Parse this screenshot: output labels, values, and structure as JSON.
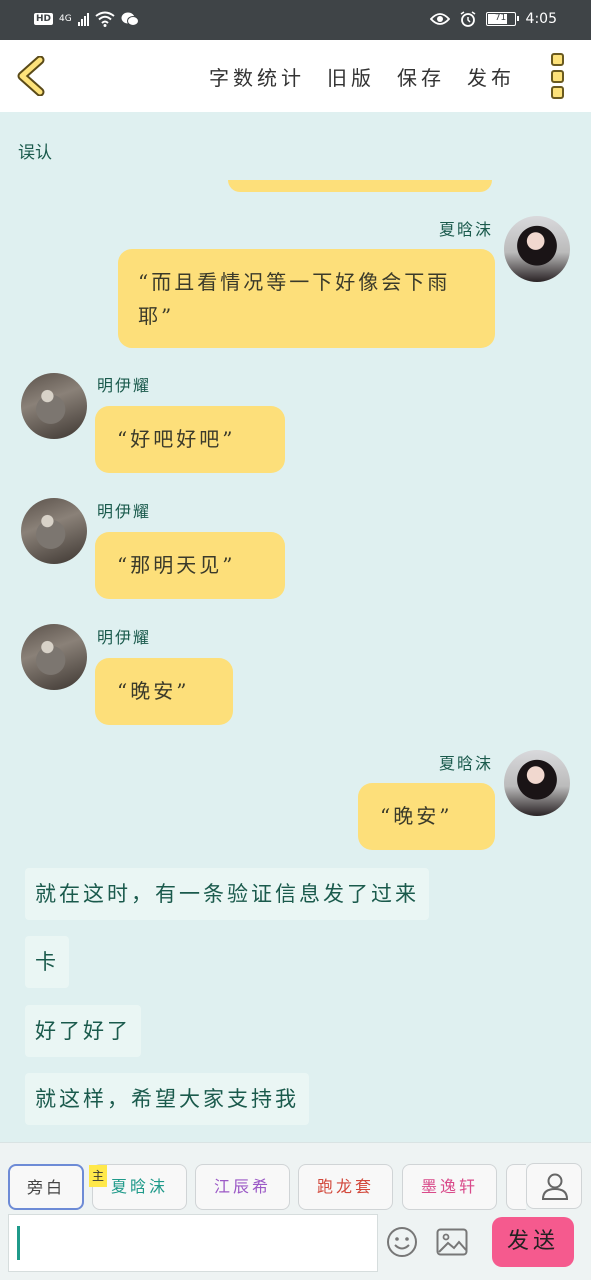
{
  "status": {
    "network": "4G",
    "hd": "HD",
    "battery": "71",
    "time": "4:05"
  },
  "toolbar": {
    "word_count": "字数统计",
    "old_version": "旧版",
    "save": "保存",
    "publish": "发布"
  },
  "chat": {
    "note": "误认",
    "messages": [
      {
        "speaker": "夏晗沫",
        "text": "“而且看情况等一下好像会下雨耶”"
      },
      {
        "speaker": "明伊耀",
        "text": "“好吧好吧”"
      },
      {
        "speaker": "明伊耀",
        "text": "“那明天见”"
      },
      {
        "speaker": "明伊耀",
        "text": "“晚安”"
      },
      {
        "speaker": "夏晗沫",
        "text": "“晚安”"
      }
    ],
    "narration": [
      "就在这时，有一条验证信息发了过来",
      "卡",
      "好了好了",
      "就这样，希望大家支持我"
    ]
  },
  "roles": {
    "tag": "主",
    "items": [
      {
        "label": "旁白",
        "color": "#444444"
      },
      {
        "label": "夏晗沫",
        "color": "#1f9a8a"
      },
      {
        "label": "江辰希",
        "color": "#9b59c6"
      },
      {
        "label": "跑龙套",
        "color": "#d2483b"
      },
      {
        "label": "墨逸轩",
        "color": "#d94a8a"
      }
    ]
  },
  "input": {
    "value": "",
    "send_label": "发送"
  }
}
